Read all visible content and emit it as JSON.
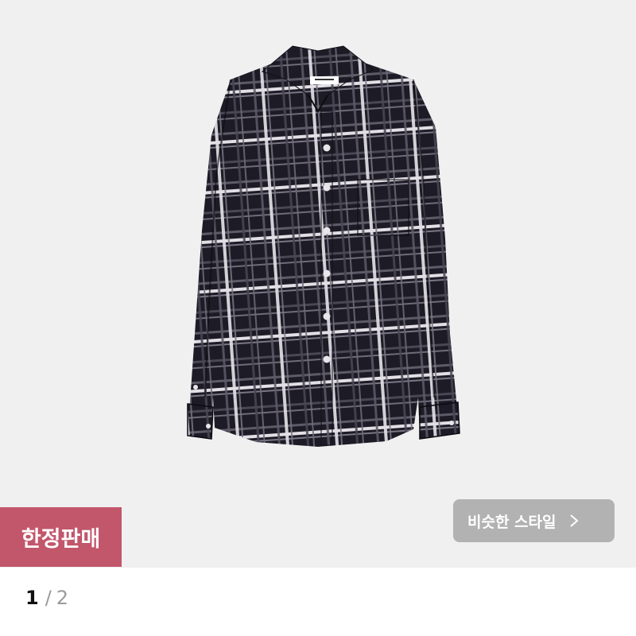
{
  "product": {
    "image_alt_icon": "plaid-shirt-image",
    "colors": {
      "background": "#f0f0f1",
      "shirt_base": "#1d1b25",
      "check_light": "#d9d6dc",
      "check_mid": "#6e6b78",
      "badge": "#c2566b"
    }
  },
  "badge": {
    "label": "한정판매"
  },
  "similar_style": {
    "label": "비슷한 스타일",
    "icon": "chevron-right-icon"
  },
  "pager": {
    "current": "1",
    "separator": "/",
    "total": "2"
  }
}
